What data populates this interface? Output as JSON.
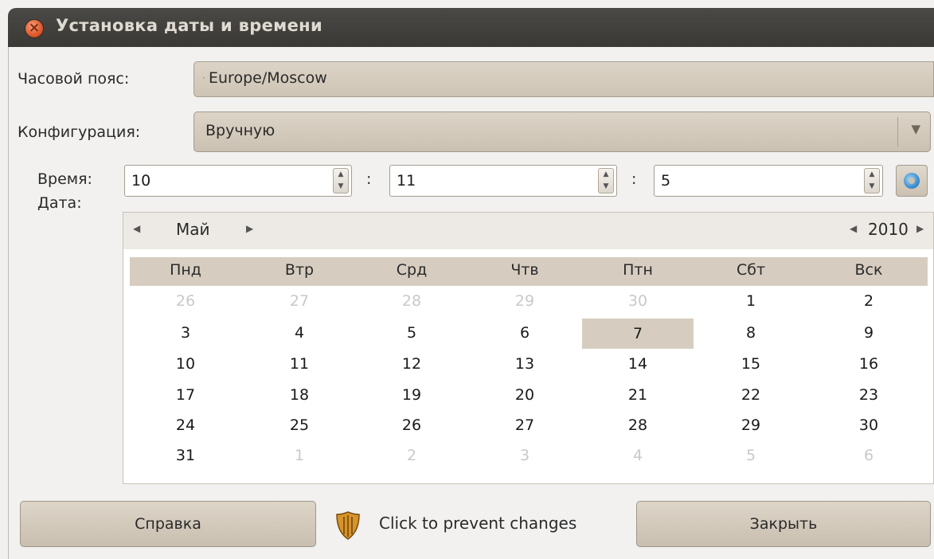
{
  "window": {
    "title": "Установка даты и времени"
  },
  "timezone": {
    "label": "Часовой пояс:",
    "value": "Europe/Moscow"
  },
  "configuration": {
    "label": "Конфигурация:",
    "value": "Вручную"
  },
  "time": {
    "label": "Время:",
    "hours": "10",
    "minutes": "11",
    "seconds": "5",
    "separator": ":"
  },
  "date": {
    "label": "Дата:",
    "month": "Май",
    "year": "2010",
    "weekdays": [
      "Пнд",
      "Втр",
      "Срд",
      "Чтв",
      "Птн",
      "Сбт",
      "Вск"
    ],
    "weeks": [
      [
        {
          "d": "26",
          "dim": true
        },
        {
          "d": "27",
          "dim": true
        },
        {
          "d": "28",
          "dim": true
        },
        {
          "d": "29",
          "dim": true
        },
        {
          "d": "30",
          "dim": true
        },
        {
          "d": "1"
        },
        {
          "d": "2"
        }
      ],
      [
        {
          "d": "3"
        },
        {
          "d": "4"
        },
        {
          "d": "5"
        },
        {
          "d": "6"
        },
        {
          "d": "7",
          "selected": true
        },
        {
          "d": "8"
        },
        {
          "d": "9"
        }
      ],
      [
        {
          "d": "10"
        },
        {
          "d": "11"
        },
        {
          "d": "12"
        },
        {
          "d": "13"
        },
        {
          "d": "14"
        },
        {
          "d": "15"
        },
        {
          "d": "16"
        }
      ],
      [
        {
          "d": "17"
        },
        {
          "d": "18"
        },
        {
          "d": "19"
        },
        {
          "d": "20"
        },
        {
          "d": "21"
        },
        {
          "d": "22"
        },
        {
          "d": "23"
        }
      ],
      [
        {
          "d": "24"
        },
        {
          "d": "25"
        },
        {
          "d": "26"
        },
        {
          "d": "27"
        },
        {
          "d": "28"
        },
        {
          "d": "29"
        },
        {
          "d": "30"
        }
      ],
      [
        {
          "d": "31"
        },
        {
          "d": "1",
          "dim": true
        },
        {
          "d": "2",
          "dim": true
        },
        {
          "d": "3",
          "dim": true
        },
        {
          "d": "4",
          "dim": true
        },
        {
          "d": "5",
          "dim": true
        },
        {
          "d": "6",
          "dim": true
        }
      ]
    ]
  },
  "buttons": {
    "help": "Справка",
    "lock": "Click to prevent changes",
    "close": "Закрыть"
  },
  "icons": {
    "close": "close-icon",
    "sync": "sync-icon",
    "lock": "shield-lock-icon",
    "dropdown": "chevron-down-icon"
  },
  "colors": {
    "titlebar": "#3f3e3a",
    "selection": "#d6cdc0",
    "field": "#d6cdc0"
  }
}
